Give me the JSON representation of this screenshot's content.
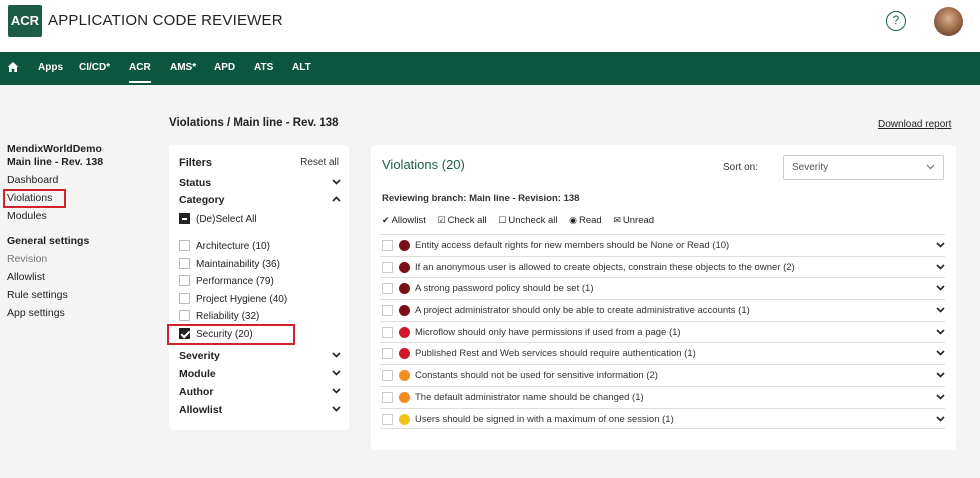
{
  "header": {
    "logo": "ACR",
    "title": "APPLICATION CODE REVIEWER",
    "help_glyph": "?"
  },
  "nav": {
    "items": [
      {
        "label": "Apps"
      },
      {
        "label": "CI/CD*"
      },
      {
        "label": "ACR"
      },
      {
        "label": "AMS*"
      },
      {
        "label": "APD"
      },
      {
        "label": "ATS"
      },
      {
        "label": "ALT"
      }
    ],
    "active": "ACR"
  },
  "sidebar": {
    "project_name": "MendixWorldDemo",
    "project_rev": "Main line - Rev. 138",
    "links": [
      "Dashboard",
      "Violations",
      "Modules"
    ],
    "settings_heading": "General settings",
    "settings_links": [
      "Revision",
      "Allowlist",
      "Rule settings",
      "App settings"
    ]
  },
  "page": {
    "heading": "Violations / Main line - Rev. 138",
    "download": "Download report"
  },
  "filters": {
    "title": "Filters",
    "reset": "Reset all",
    "status_label": "Status",
    "category_label": "Category",
    "deselect_all": "(De)Select All",
    "categories": [
      {
        "label": "Architecture (10)",
        "checked": false
      },
      {
        "label": "Maintainability (36)",
        "checked": false
      },
      {
        "label": "Performance (79)",
        "checked": false
      },
      {
        "label": "Project Hygiene (40)",
        "checked": false
      },
      {
        "label": "Reliability (32)",
        "checked": false
      },
      {
        "label": "Security (20)",
        "checked": true
      }
    ],
    "severity_label": "Severity",
    "module_label": "Module",
    "author_label": "Author",
    "allowlist_label": "Allowlist"
  },
  "violations": {
    "title": "Violations (20)",
    "sort_label": "Sort on:",
    "sort_value": "Severity",
    "branch": "Reviewing branch: Main line - Revision: 138",
    "actions": {
      "allowlist": "Allowlist",
      "check_all": "Check all",
      "uncheck_all": "Uncheck all",
      "read": "Read",
      "unread": "Unread"
    },
    "rows": [
      {
        "text": "Entity access default rights for new members should be None or Read (10)",
        "severity_color": "#7a0f16"
      },
      {
        "text": "If an anonymous user is allowed to create objects, constrain these objects to the owner (2)",
        "severity_color": "#7a0f16"
      },
      {
        "text": "A strong password policy should be set (1)",
        "severity_color": "#7a0f16"
      },
      {
        "text": "A project administrator should only be able to create administrative accounts (1)",
        "severity_color": "#7a0f16"
      },
      {
        "text": "Microflow should only have permissions if used from a page (1)",
        "severity_color": "#d0182a"
      },
      {
        "text": "Published Rest and Web services should require authentication (1)",
        "severity_color": "#d0182a"
      },
      {
        "text": "Constants should not be used for sensitive information (2)",
        "severity_color": "#f28c1e"
      },
      {
        "text": "The default administrator name should be changed (1)",
        "severity_color": "#f28c1e"
      },
      {
        "text": "Users should be signed in with a maximum of one session (1)",
        "severity_color": "#f5c21a"
      }
    ]
  },
  "colors": {
    "brand": "#0c5640",
    "highlight": "#d0232f"
  }
}
